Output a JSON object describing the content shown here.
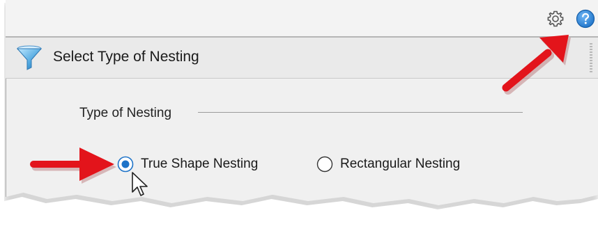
{
  "toolbar": {
    "settings_icon": "gear-icon",
    "help_icon": "help-icon",
    "help_color": "#1e73c8"
  },
  "section": {
    "icon": "funnel-icon",
    "title": "Select Type of Nesting"
  },
  "nesting_group": {
    "label": "Type of Nesting",
    "options": [
      {
        "label": "True Shape Nesting",
        "selected": true
      },
      {
        "label": "Rectangular Nesting",
        "selected": false
      }
    ]
  },
  "annotations": {
    "arrow_color": "#e3141b",
    "arrows": [
      "arrow-to-help-icon",
      "arrow-to-true-shape-option"
    ]
  }
}
